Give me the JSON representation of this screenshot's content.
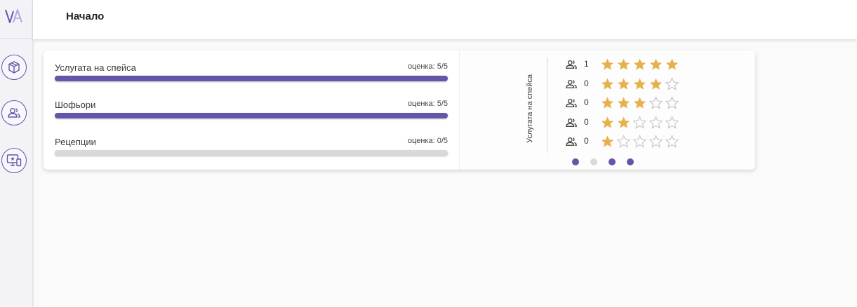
{
  "header": {
    "title": "Начало"
  },
  "sidebar": {
    "items": [
      {
        "name": "box-icon"
      },
      {
        "name": "users-icon"
      },
      {
        "name": "monitor-star-icon"
      }
    ]
  },
  "metrics": [
    {
      "label": "Услугата на спейса",
      "score": "оценка: 5/5",
      "fraction": 1.0
    },
    {
      "label": "Шофьори",
      "score": "оценка: 5/5",
      "fraction": 1.0
    },
    {
      "label": "Рецепции",
      "score": "оценка: 0/5",
      "fraction": 0.0
    }
  ],
  "ratings_panel": {
    "title": "Услугата на спейса",
    "rows": [
      {
        "count": "1",
        "stars": 5
      },
      {
        "count": "0",
        "stars": 4
      },
      {
        "count": "0",
        "stars": 3
      },
      {
        "count": "0",
        "stars": 2
      },
      {
        "count": "0",
        "stars": 1
      }
    ],
    "max_stars": 5,
    "pagination": {
      "total": 4,
      "active": [
        0,
        2,
        3
      ]
    }
  },
  "colors": {
    "accent": "#6356a8",
    "star_filled": "#e8b04d",
    "star_empty": "#c8c8c8",
    "bar_empty": "#d9d9d9",
    "dot_inactive": "#dadada"
  }
}
